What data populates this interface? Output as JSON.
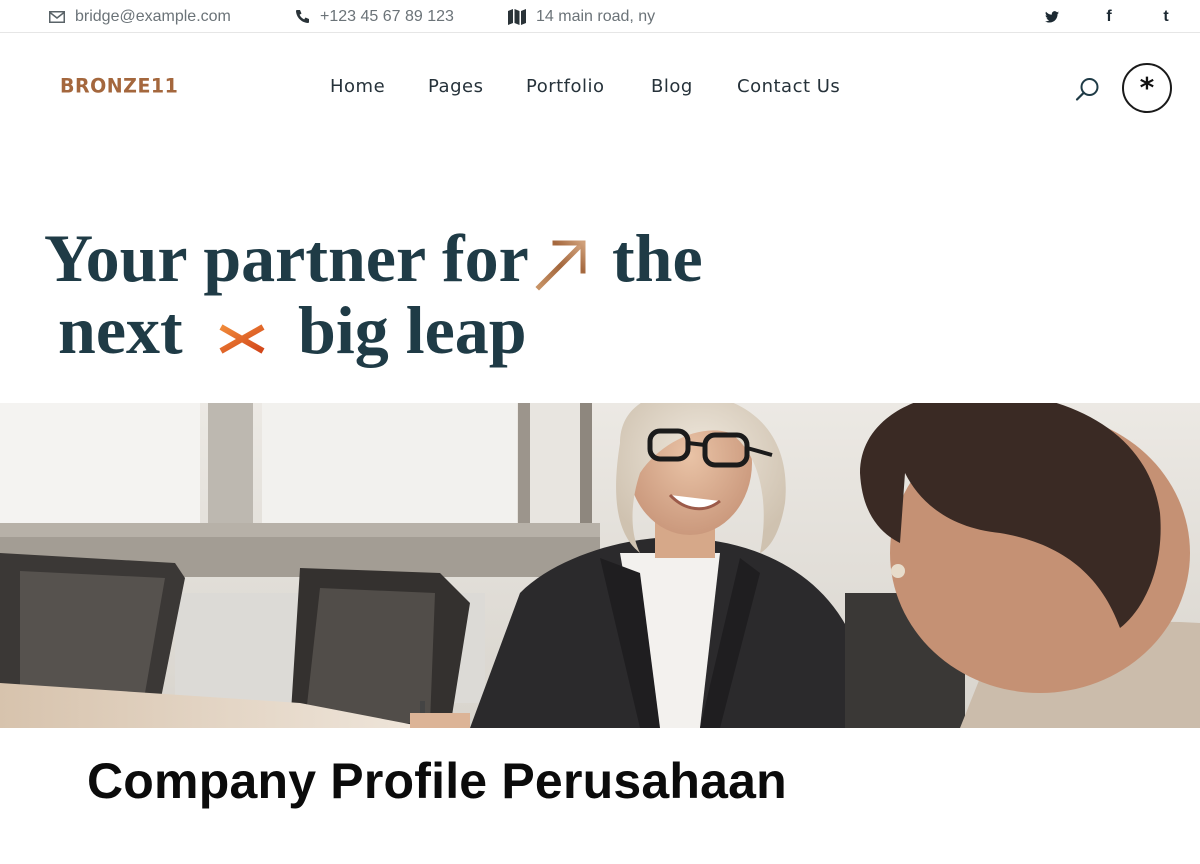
{
  "topbar": {
    "email": "bridge@example.com",
    "phone": "+123 45 67 89 123",
    "address": "14 main road, ny",
    "icons": {
      "email": "envelope-icon",
      "phone": "phone-icon",
      "address": "map-icon"
    },
    "social": [
      {
        "name": "twitter",
        "glyph": "🐦"
      },
      {
        "name": "facebook",
        "glyph": "f"
      },
      {
        "name": "tumblr",
        "glyph": "t"
      }
    ]
  },
  "header": {
    "logo": "BRONZE11",
    "nav": [
      "Home",
      "Pages",
      "Portfolio",
      "Blog",
      "Contact Us"
    ],
    "search_icon": "search-icon",
    "menu_glyph": "*"
  },
  "hero": {
    "line1_a": "Your partner for",
    "line1_b": "the",
    "line2_a": "next",
    "line2_b": "big leap",
    "arrow_icon": "arrow-up-right-icon",
    "asterisk_icon": "asterisk-icon"
  },
  "photo": {
    "alt": "photo"
  },
  "caption": "Company Profile Perusahaan",
  "colors": {
    "accent_bronze": "#a4673d",
    "accent_orange": "#e0621f",
    "heading": "#1f3b46",
    "muted": "#6b7378"
  }
}
